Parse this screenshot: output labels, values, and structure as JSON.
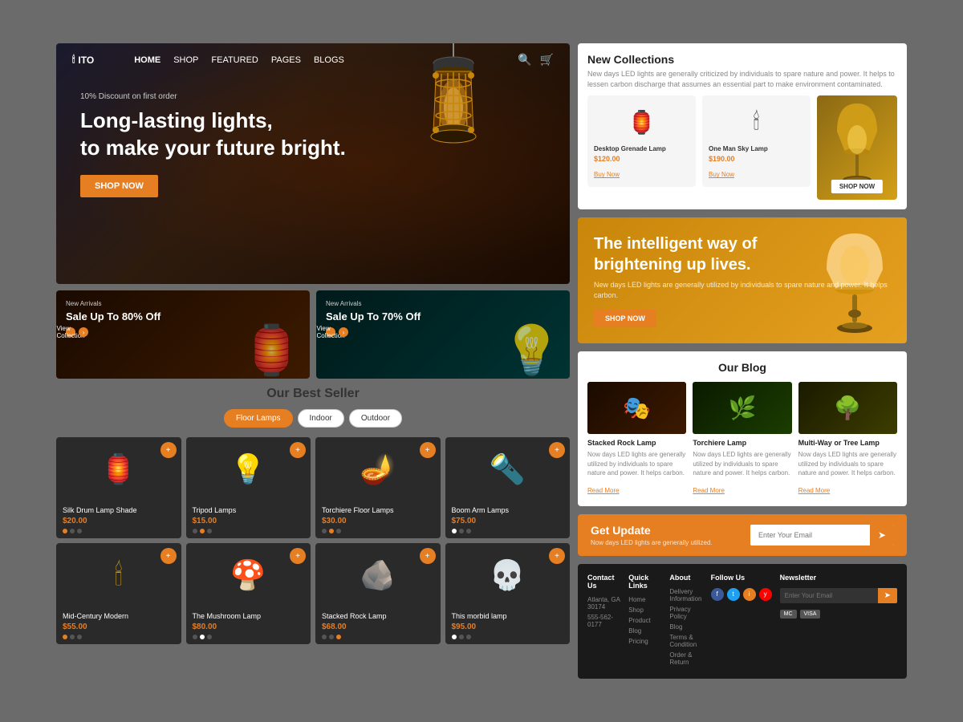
{
  "header": {
    "logo": "ITO",
    "logo_icon": "🕯",
    "nav": [
      "HOME",
      "SHOP",
      "FEATURED",
      "PAGES",
      "BLOGS"
    ],
    "active_nav": "HOME"
  },
  "hero": {
    "discount_text": "10% Discount on first order",
    "title_line1": "Long-lasting lights,",
    "title_line2": "to make your future bright.",
    "cta_label": "SHOP NOW"
  },
  "promo": {
    "card1": {
      "badge": "New Arrivals",
      "title": "Sale Up To 80% Off",
      "link_label": "View Collection"
    },
    "card2": {
      "badge": "New Arrivals",
      "title": "Sale Up To 70% Off",
      "link_label": "View Collection"
    }
  },
  "best_seller": {
    "section_title": "Our Best Seller",
    "tabs": [
      "Floor Lamps",
      "Indoor",
      "Outdoor"
    ],
    "active_tab": "Floor Lamps",
    "products_row1": [
      {
        "name": "Silk Drum Lamp Shade",
        "price": "$20.00",
        "emoji": "🏮",
        "dots": [
          "orange",
          "dark",
          "dark"
        ]
      },
      {
        "name": "Tripod Lamps",
        "price": "$15.00",
        "emoji": "💡",
        "dots": [
          "dark",
          "orange",
          "dark"
        ]
      },
      {
        "name": "Torchiere Floor Lamps",
        "price": "$30.00",
        "emoji": "🪔",
        "dots": [
          "dark",
          "orange",
          "dark"
        ]
      },
      {
        "name": "Boom Arm Lamps",
        "price": "$75.00",
        "emoji": "🔦",
        "dots": [
          "white",
          "dark",
          "dark"
        ]
      }
    ],
    "products_row2": [
      {
        "name": "Mid-Century Modern",
        "price": "$55.00",
        "emoji": "🕯",
        "dots": [
          "orange",
          "dark",
          "dark"
        ]
      },
      {
        "name": "The Mushroom Lamp",
        "price": "$80.00",
        "emoji": "🍄",
        "dots": [
          "dark",
          "white",
          "dark"
        ]
      },
      {
        "name": "Stacked Rock Lamp",
        "price": "$68.00",
        "emoji": "🪨",
        "dots": [
          "dark",
          "dark",
          "orange"
        ]
      },
      {
        "name": "This morbid lamp",
        "price": "$95.00",
        "emoji": "💀",
        "dots": [
          "white",
          "dark",
          "dark"
        ]
      }
    ]
  },
  "new_collections": {
    "title": "New Collections",
    "desc": "New days LED lights are generally criticized by individuals to spare nature and power. It helps to lessen carbon discharge that assumes an essential part to make environment contaminated.",
    "products": [
      {
        "name": "Desktop Grenade Lamp",
        "price": "$120.00",
        "emoji": "🏮"
      },
      {
        "name": "One Man Sky Lamp",
        "price": "$190.00",
        "emoji": "🕯"
      }
    ],
    "featured_btn": "SHOP NOW"
  },
  "bright_lives": {
    "title_line1": "The intelligent way of",
    "title_line2": "brightening up lives.",
    "desc": "New days LED lights are generally utilized by individuals to spare nature and power. It helps carbon.",
    "btn_label": "SHOP NOW"
  },
  "blog": {
    "section_title": "Our Blog",
    "posts": [
      {
        "title": "Stacked Rock Lamp",
        "desc": "Now days LED lights are generally utilized by individuals to spare nature and power. It helps carbon.",
        "read_more": "Read More",
        "emoji": "🎭"
      },
      {
        "title": "Torchiere Lamp",
        "desc": "Now days LED lights are generally utilized by individuals to spare nature and power. It helps carbon.",
        "read_more": "Read More",
        "emoji": "🌿"
      },
      {
        "title": "Multi-Way or Tree Lamp",
        "desc": "Now days LED lights are generally utilized by individuals to spare nature and power. It helps carbon.",
        "read_more": "Read More",
        "emoji": "🌳"
      }
    ]
  },
  "get_update": {
    "title": "Get Update",
    "desc": "Now days LED lights are generally utilized.",
    "input_placeholder": "Enter Your Email",
    "btn_label": "➤"
  },
  "footer": {
    "cols": [
      {
        "title": "Contact Us",
        "items": [
          "Atlanta, GA 30174",
          "555-562-0177"
        ]
      },
      {
        "title": "Quick Links",
        "items": [
          "Home",
          "Shop",
          "Product",
          "Blog",
          "Pricing"
        ]
      },
      {
        "title": "About",
        "items": [
          "Delivery Information",
          "Privacy Policy",
          "Blog",
          "Terms & Condition",
          "Order & Return"
        ]
      },
      {
        "title": "Follow Us",
        "social": [
          "f",
          "t",
          "i",
          "y"
        ]
      },
      {
        "title": "Newsletter",
        "input_placeholder": "Enter Your Email",
        "btn": "➤",
        "payment": [
          "MC",
          "VISA"
        ]
      }
    ]
  },
  "colors": {
    "accent": "#e67e22",
    "dark_bg": "#2a2a2a",
    "text_muted": "#888888"
  }
}
